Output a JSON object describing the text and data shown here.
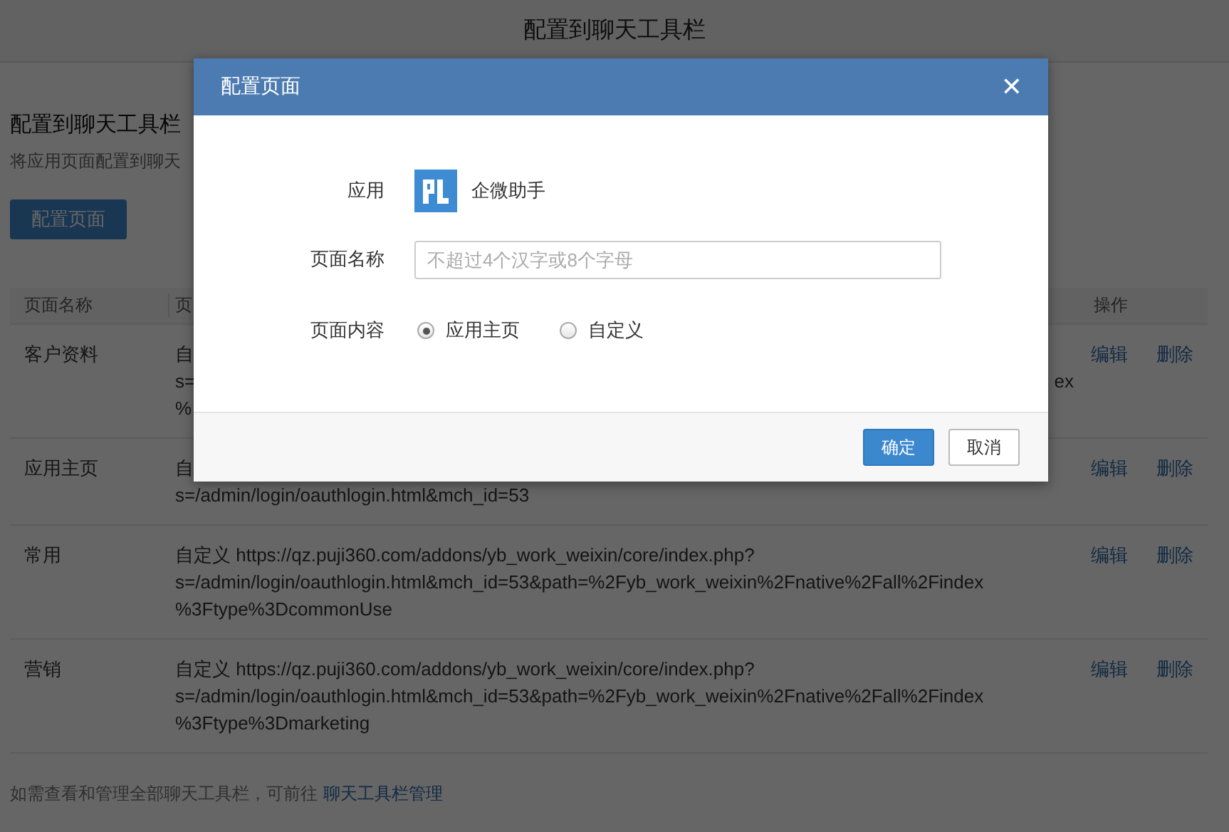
{
  "top_bar": {
    "title": "配置到聊天工具栏"
  },
  "page": {
    "heading": "配置到聊天工具栏",
    "subtitle": "将应用页面配置到聊天",
    "add_button": "配置页面",
    "table": {
      "columns": [
        "页面名称",
        "页",
        "操作"
      ],
      "rows": [
        {
          "name": "客户资料",
          "content_lines": [
            "自",
            "s=",
            "%"
          ],
          "content_tail": "ex",
          "actions": [
            "编辑",
            "删除"
          ]
        },
        {
          "name": "应用主页",
          "content_lines": [
            "自",
            "s=/admin/login/oauthlogin.html&mch_id=53"
          ],
          "actions": [
            "编辑",
            "删除"
          ]
        },
        {
          "name": "常用",
          "content_lines": [
            "自定义  https://qz.puji360.com/addons/yb_work_weixin/core/index.php?",
            "s=/admin/login/oauthlogin.html&mch_id=53&path=%2Fyb_work_weixin%2Fnative%2Fall%2Findex",
            "%3Ftype%3DcommonUse"
          ],
          "actions": [
            "编辑",
            "删除"
          ]
        },
        {
          "name": "营销",
          "content_lines": [
            "自定义  https://qz.puji360.com/addons/yb_work_weixin/core/index.php?",
            "s=/admin/login/oauthlogin.html&mch_id=53&path=%2Fyb_work_weixin%2Fnative%2Fall%2Findex",
            "%3Ftype%3Dmarketing"
          ],
          "actions": [
            "编辑",
            "删除"
          ]
        }
      ]
    },
    "footer": {
      "text": "如需查看和管理全部聊天工具栏，可前往",
      "link": "聊天工具栏管理"
    }
  },
  "dialog": {
    "title": "配置页面",
    "close": "✕",
    "app_label": "应用",
    "app_name": "企微助手",
    "name_label": "页面名称",
    "name_placeholder": "不超过4个汉字或8个字母",
    "content_label": "页面内容",
    "content_options": [
      {
        "label": "应用主页",
        "selected": true
      },
      {
        "label": "自定义",
        "selected": false
      }
    ],
    "buttons": [
      {
        "label": "确定",
        "kind": "primary"
      },
      {
        "label": "取消",
        "kind": "default"
      }
    ]
  }
}
